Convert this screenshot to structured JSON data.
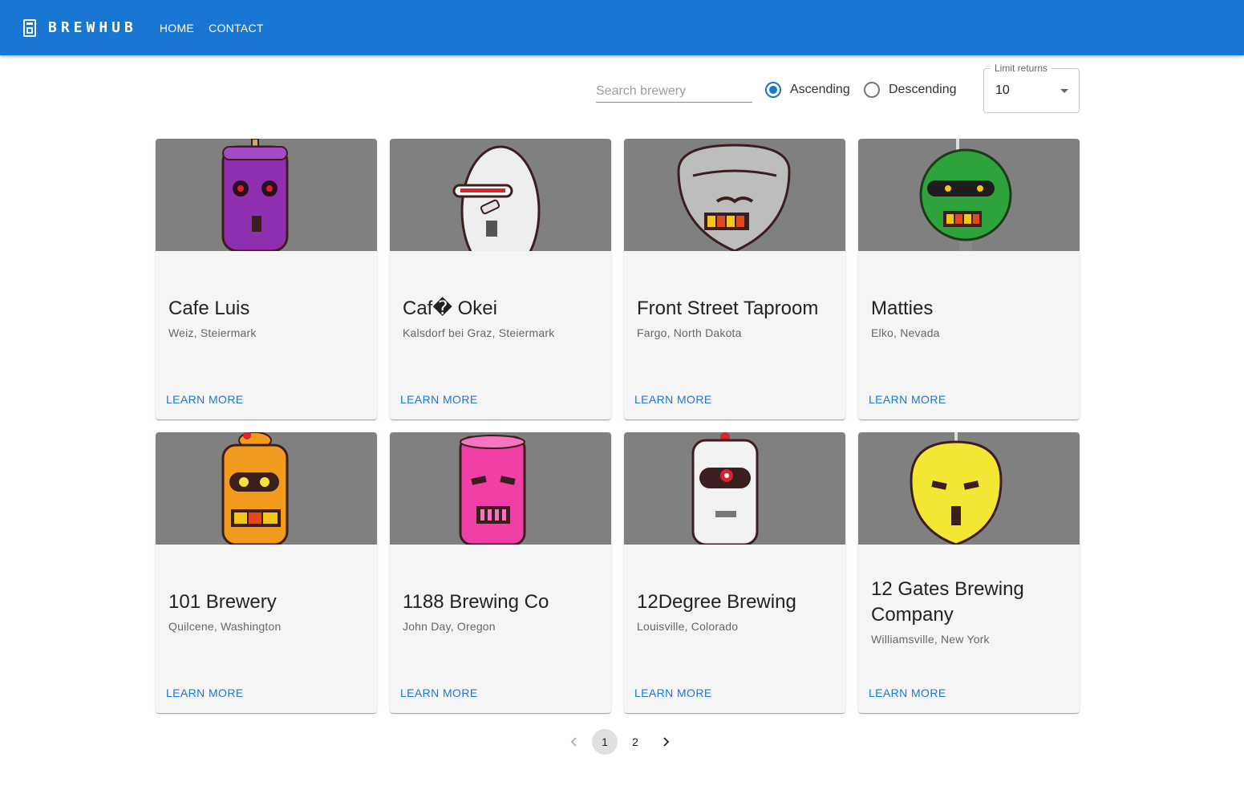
{
  "app": {
    "brand": "BREWHUB",
    "nav": [
      "HOME",
      "CONTACT"
    ]
  },
  "controls": {
    "search_placeholder": "Search brewery",
    "search_value": "",
    "sort_options": [
      {
        "label": "Ascending",
        "checked": true
      },
      {
        "label": "Descending",
        "checked": false
      }
    ],
    "limit_label": "Limit returns",
    "limit_value": "10"
  },
  "cards": [
    {
      "name": "Cafe Luis",
      "location": "Weiz, Steiermark",
      "action": "LEARN MORE",
      "robot_color": "#8e2fb0",
      "robot_icon": "robot-purple-icon"
    },
    {
      "name": "Caf� Okei",
      "location": "Kalsdorf bei Graz, Steiermark",
      "action": "LEARN MORE",
      "robot_color": "#eeeeee",
      "robot_icon": "robot-white-icon"
    },
    {
      "name": "Front Street Taproom",
      "location": "Fargo, North Dakota",
      "action": "LEARN MORE",
      "robot_color": "#bdbdbd",
      "robot_icon": "robot-gray-icon"
    },
    {
      "name": "Matties",
      "location": "Elko, Nevada",
      "action": "LEARN MORE",
      "robot_color": "#2ea33c",
      "robot_icon": "robot-green-icon"
    },
    {
      "name": "101 Brewery",
      "location": "Quilcene, Washington",
      "action": "LEARN MORE",
      "robot_color": "#f29a1e",
      "robot_icon": "robot-orange-icon"
    },
    {
      "name": "1188 Brewing Co",
      "location": "John Day, Oregon",
      "action": "LEARN MORE",
      "robot_color": "#f03fa6",
      "robot_icon": "robot-pink-icon"
    },
    {
      "name": "12Degree Brewing",
      "location": "Louisville, Colorado",
      "action": "LEARN MORE",
      "robot_color": "#f2f2f2",
      "robot_icon": "robot-white-red-eye-icon"
    },
    {
      "name": "12 Gates Brewing Company",
      "location": "Williamsville, New York",
      "action": "LEARN MORE",
      "robot_color": "#f3e634",
      "robot_icon": "robot-yellow-icon"
    }
  ],
  "pagination": {
    "prev_icon": "chevron-left-icon",
    "pages": [
      "1",
      "2"
    ],
    "current": "1",
    "next_icon": "chevron-right-icon"
  },
  "colors": {
    "primary": "#1976d2",
    "card_bg": "#f5f5f5",
    "media_bg": "#808080"
  }
}
